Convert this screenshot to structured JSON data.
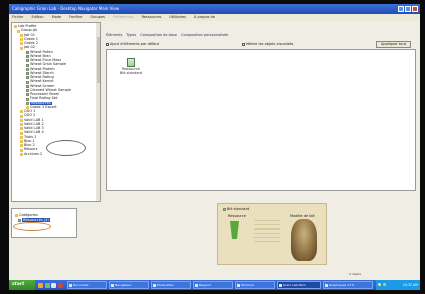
{
  "window": {
    "title": "Calligraphic Grain Lab - Desktop Navigator Main View"
  },
  "menubar": [
    "Fichier",
    "Edition",
    "Mode",
    "Fenêtre",
    "Groupes",
    "Préférences",
    "Ressources",
    "Utilitaires",
    "À propos de"
  ],
  "tree": {
    "items": [
      {
        "label": "Lab Profile",
        "icon": "folder-icon"
      },
      {
        "label": "Group-Jbi",
        "icon": "folder-icon"
      },
      {
        "label": "Job 01",
        "icon": "folder-icon"
      },
      {
        "label": "Grade 1",
        "icon": "folder-icon"
      },
      {
        "label": "Grade 2",
        "icon": "folder-icon"
      },
      {
        "label": "Job 02",
        "icon": "folder-icon"
      },
      {
        "label": "Wheat Pollen",
        "icon": "page-icon"
      },
      {
        "label": "Wheat Bran",
        "icon": "page-icon"
      },
      {
        "label": "Wheat Flour Mass",
        "icon": "page-icon"
      },
      {
        "label": "Wheat Grain Sample",
        "icon": "page-icon"
      },
      {
        "label": "Wheat Protein",
        "icon": "page-icon"
      },
      {
        "label": "Wheat Starch",
        "icon": "page-icon"
      },
      {
        "label": "Wheat Rating",
        "icon": "page-icon"
      },
      {
        "label": "Wheat Kernel",
        "icon": "page-icon"
      },
      {
        "label": "Wheat Screen",
        "icon": "page-icon"
      },
      {
        "label": "Cleaned Wheat Sample",
        "icon": "page-icon"
      },
      {
        "label": "Processed Sheet",
        "icon": "page-icon"
      },
      {
        "label": "Final Rating Set",
        "icon": "page-icon"
      },
      {
        "label": "Ressources",
        "icon": "page-icon"
      },
      {
        "label": "Grade 3 Export",
        "icon": "folder-icon"
      },
      {
        "label": "QUO 1",
        "icon": "folder-icon"
      },
      {
        "label": "QUO 2",
        "icon": "folder-icon"
      },
      {
        "label": "Valid LAB 1",
        "icon": "folder-icon"
      },
      {
        "label": "Valid LAB 2",
        "icon": "folder-icon"
      },
      {
        "label": "Valid LAB 3",
        "icon": "folder-icon"
      },
      {
        "label": "Valid LAB 4",
        "icon": "folder-icon"
      },
      {
        "label": "Trials 1",
        "icon": "folder-icon"
      },
      {
        "label": "Bloc 1",
        "icon": "folder-icon"
      },
      {
        "label": "Bloc 2",
        "icon": "folder-icon"
      },
      {
        "label": "Retours",
        "icon": "folder-icon"
      },
      {
        "label": "Archives 2",
        "icon": "folder-icon"
      }
    ]
  },
  "bottom_pane": {
    "items": [
      {
        "label": "Catégories"
      },
      {
        "label": "Ressources (4)"
      }
    ]
  },
  "tabs": [
    "Éléments",
    "Types",
    "Composition de base",
    "Composition personnalisée"
  ],
  "toolbar": {
    "option_a": "Ajout d'éléments par défaut",
    "option_b": "Mettre les objets visualisés",
    "action_button": "Appliquer tout"
  },
  "content": {
    "items": [
      {
        "label_line1": "Ressource",
        "label_line2": "Blé standard"
      }
    ]
  },
  "preview": {
    "header": "Blé standard",
    "col1": "Ressource",
    "col2": "Modèle de blé"
  },
  "taskbar": {
    "start_label": "start",
    "buttons": [
      "Document",
      "Navigateur",
      "Explorateur",
      "Rapport",
      "Terminal",
      "Grain Lab Main",
      "Graphiques 17.5"
    ],
    "clock": "10:32 AM"
  },
  "status": "4 objets",
  "colors": {
    "selection": "#2a55b8",
    "titlebar": "#1d4fb7",
    "preview_bg": "#ebe0bd"
  }
}
